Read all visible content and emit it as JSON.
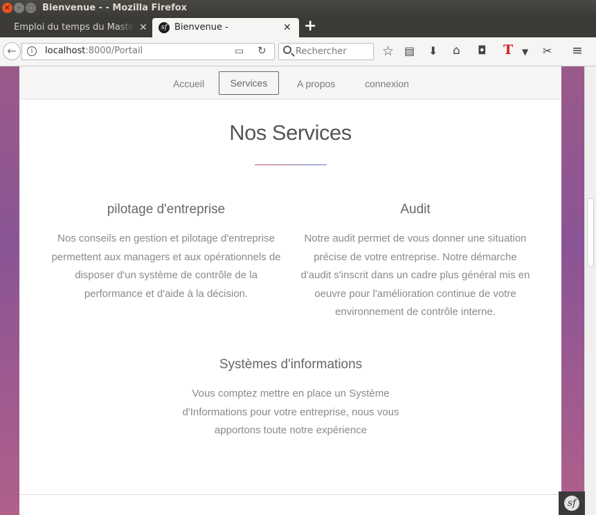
{
  "window": {
    "title": "Bienvenue - - Mozilla Firefox"
  },
  "tabs": [
    {
      "label": "Emploi du temps du Master GL",
      "active": false
    },
    {
      "label": "Bienvenue -",
      "active": true
    }
  ],
  "navbar": {
    "url_host": "localhost",
    "url_rest": ":8000/Portail",
    "search_placeholder": "Rechercher"
  },
  "site": {
    "nav": [
      {
        "label": "Accueil"
      },
      {
        "label": "Services"
      },
      {
        "label": "A propos"
      },
      {
        "label": "connexion"
      }
    ],
    "active_nav": "Services",
    "section_title": "Nos Services",
    "services": [
      {
        "title": "pilotage d'entreprise",
        "lines": [
          "Nos conseils en gestion et pilotage d'entreprise",
          "permettent aux managers et aux opérationnels de",
          "disposer d'un système de contrôle de la",
          "performance et d'aide à la décision."
        ]
      },
      {
        "title": "Audit",
        "lines": [
          "Notre audit permet de vous donner une situation",
          "précise de votre entreprise. Notre démarche",
          "d'audit s'inscrit dans un cadre plus général mis en",
          "oeuvre pour l'amélioration continue de votre",
          "environnement de contrôle interne."
        ]
      },
      {
        "title": "Systèmes d'informations",
        "lines": [
          "Vous comptez mettre en place un Système",
          "d'Informations pour votre entreprise, nous vous",
          "apportons toute notre expérience"
        ]
      }
    ]
  },
  "colors": {
    "accent_left": "#e49aa8",
    "accent_right": "#9ab4e0",
    "ubuntu_close": "#e95420"
  }
}
